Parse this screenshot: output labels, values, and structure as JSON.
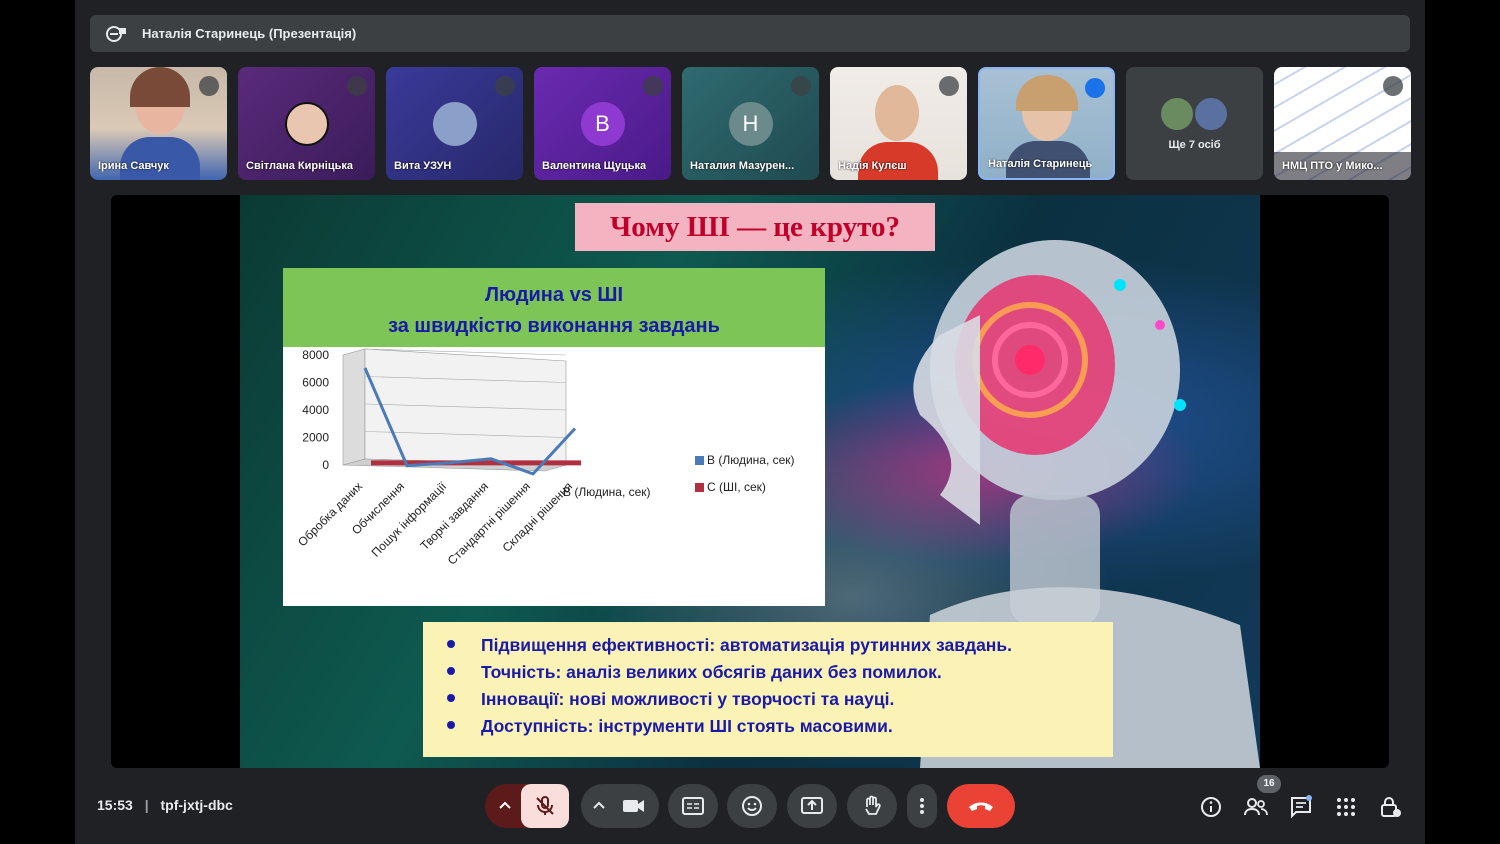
{
  "presenter_bar": {
    "title": "Наталія Старинець (Презентація)"
  },
  "participants": [
    {
      "name": "Ірина Савчук",
      "muted": true
    },
    {
      "name": "Світлана Кирніцька",
      "muted": true
    },
    {
      "name": "Вита УЗУН",
      "muted": true
    },
    {
      "name": "Валентина Щуцька",
      "initial": "B",
      "muted": true
    },
    {
      "name": "Наталия Мазурен...",
      "initial": "H",
      "muted": true
    },
    {
      "name": "Надія Кулєш",
      "muted": true
    },
    {
      "name": "Наталія Старинець",
      "speaking": true
    },
    {
      "name": "Ще 7 осіб"
    },
    {
      "name": "НМЦ ПТО у Мико...",
      "muted": true
    }
  ],
  "slide": {
    "title": "Чому ШІ — це круто?",
    "chart_header_line1": "Людина vs ШІ",
    "chart_header_line2": "за швидкістю виконання завдань",
    "bullets": [
      "Підвищення ефективності: автоматизація рутинних завдань.",
      "Точність: аналіз великих обсягів даних без помилок.",
      "Інновації: нові можливості у творчості та науці.",
      "Доступність: інструменти ШІ стоять масовими."
    ]
  },
  "chart_data": {
    "type": "line",
    "categories": [
      "Обробка даних",
      "Обчислення",
      "Пошук інформації",
      "Творчі завдання",
      "Стандартні рішення",
      "Складні рішення"
    ],
    "series": [
      {
        "name": "B (Людина, сек)",
        "values": [
          7200,
          100,
          300,
          600,
          -500,
          2800
        ],
        "color": "#4a7ab8"
      },
      {
        "name": "C (ШІ, сек)",
        "values": [
          5,
          5,
          5,
          5,
          5,
          5
        ],
        "color": "#b03040"
      }
    ],
    "ylim": [
      0,
      8000
    ],
    "yticks": [
      "8000",
      "6000",
      "4000",
      "2000",
      "0"
    ],
    "depth_axis_label": "B (Людина, сек)",
    "legend_position": "right"
  },
  "controls": {
    "time": "15:53",
    "meeting_code": "tpf-jxtj-dbc",
    "people_count": "16"
  },
  "colors": {
    "leave": "#ea4335",
    "mic_off": "#f9dedc",
    "accent": "#8ab4f8"
  }
}
